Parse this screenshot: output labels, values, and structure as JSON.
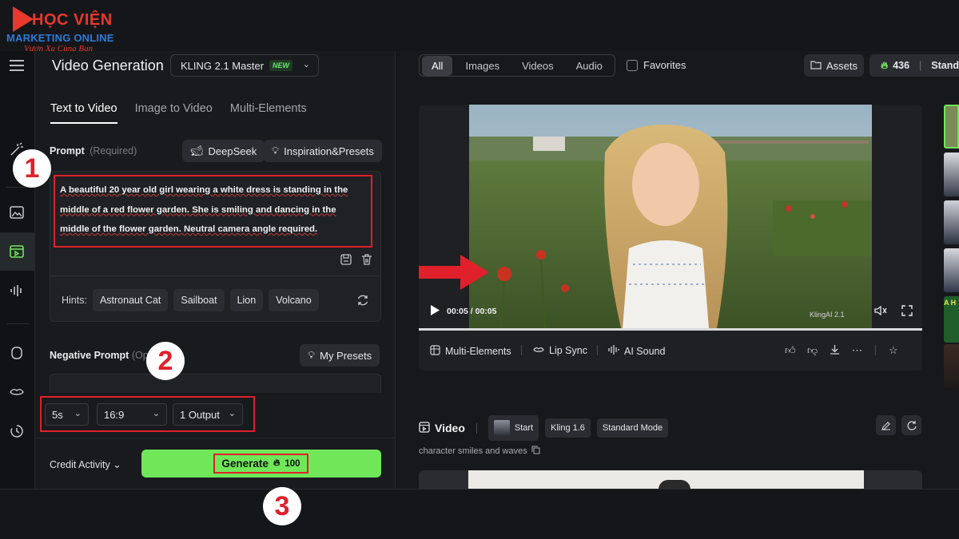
{
  "brand": {
    "line1": "HỌC VIỆN",
    "line2": "MARKETING ONLINE",
    "line3": "Vươn Xa Cùng Bạn",
    "red": "#e8392c",
    "blue": "#2e7bd6"
  },
  "header": {
    "title": "Video Generation",
    "model": "KLING 2.1 Master",
    "model_badge": "NEW"
  },
  "tabs": [
    "Text to Video",
    "Image to Video",
    "Multi-Elements"
  ],
  "prompt": {
    "label": "Prompt",
    "required": "(Required)",
    "deepseek": "DeepSeek",
    "presets": "Inspiration&Presets",
    "text": "A beautiful 20 year old girl wearing a white dress is standing in the middle of a red flower garden. She is smiling and dancing in the middle of the flower garden. Neutral camera angle required."
  },
  "hints": {
    "label": "Hints:",
    "items": [
      "Astronaut Cat",
      "Sailboat",
      "Lion",
      "Volcano"
    ]
  },
  "negative": {
    "label": "Negative Prompt",
    "optional": "(Op",
    "my_presets": "My Presets"
  },
  "settings": {
    "duration": "5s",
    "ratio": "16:9",
    "outputs": "1 Output"
  },
  "footer": {
    "credit_activity": "Credit Activity",
    "generate": "Generate",
    "cost": "100",
    "generate_color": "#6fe759"
  },
  "annotations": [
    "1",
    "2",
    "3"
  ],
  "filters": {
    "items": [
      "All",
      "Images",
      "Videos",
      "Audio"
    ],
    "active": "All",
    "favorites": "Favorites"
  },
  "topbar": {
    "assets": "Assets",
    "credits": "436",
    "plan": "Stand"
  },
  "player": {
    "time": "00:05 / 00:05",
    "watermark": "KlingAI 2.1",
    "progress": 1.0
  },
  "player_actions": {
    "multi_elements": "Multi-Elements",
    "lip_sync": "Lip Sync",
    "ai_sound": "AI Sound"
  },
  "video_item": {
    "title": "Video",
    "start": "Start",
    "model": "Kling 1.6",
    "mode": "Standard Mode",
    "caption": "character smiles and waves"
  },
  "right_strip": {
    "text": "A H"
  }
}
